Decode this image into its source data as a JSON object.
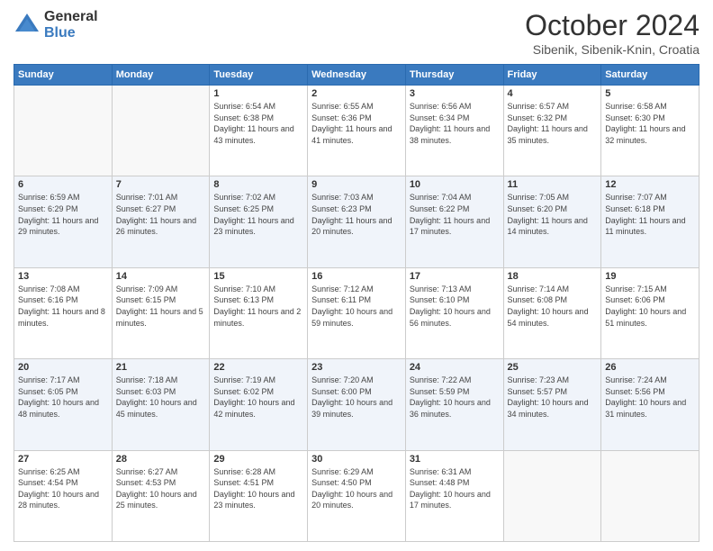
{
  "header": {
    "logo_general": "General",
    "logo_blue": "Blue",
    "month": "October 2024",
    "location": "Sibenik, Sibenik-Knin, Croatia"
  },
  "days_of_week": [
    "Sunday",
    "Monday",
    "Tuesday",
    "Wednesday",
    "Thursday",
    "Friday",
    "Saturday"
  ],
  "weeks": [
    [
      {
        "day": "",
        "info": ""
      },
      {
        "day": "",
        "info": ""
      },
      {
        "day": "1",
        "info": "Sunrise: 6:54 AM\nSunset: 6:38 PM\nDaylight: 11 hours and 43 minutes."
      },
      {
        "day": "2",
        "info": "Sunrise: 6:55 AM\nSunset: 6:36 PM\nDaylight: 11 hours and 41 minutes."
      },
      {
        "day": "3",
        "info": "Sunrise: 6:56 AM\nSunset: 6:34 PM\nDaylight: 11 hours and 38 minutes."
      },
      {
        "day": "4",
        "info": "Sunrise: 6:57 AM\nSunset: 6:32 PM\nDaylight: 11 hours and 35 minutes."
      },
      {
        "day": "5",
        "info": "Sunrise: 6:58 AM\nSunset: 6:30 PM\nDaylight: 11 hours and 32 minutes."
      }
    ],
    [
      {
        "day": "6",
        "info": "Sunrise: 6:59 AM\nSunset: 6:29 PM\nDaylight: 11 hours and 29 minutes."
      },
      {
        "day": "7",
        "info": "Sunrise: 7:01 AM\nSunset: 6:27 PM\nDaylight: 11 hours and 26 minutes."
      },
      {
        "day": "8",
        "info": "Sunrise: 7:02 AM\nSunset: 6:25 PM\nDaylight: 11 hours and 23 minutes."
      },
      {
        "day": "9",
        "info": "Sunrise: 7:03 AM\nSunset: 6:23 PM\nDaylight: 11 hours and 20 minutes."
      },
      {
        "day": "10",
        "info": "Sunrise: 7:04 AM\nSunset: 6:22 PM\nDaylight: 11 hours and 17 minutes."
      },
      {
        "day": "11",
        "info": "Sunrise: 7:05 AM\nSunset: 6:20 PM\nDaylight: 11 hours and 14 minutes."
      },
      {
        "day": "12",
        "info": "Sunrise: 7:07 AM\nSunset: 6:18 PM\nDaylight: 11 hours and 11 minutes."
      }
    ],
    [
      {
        "day": "13",
        "info": "Sunrise: 7:08 AM\nSunset: 6:16 PM\nDaylight: 11 hours and 8 minutes."
      },
      {
        "day": "14",
        "info": "Sunrise: 7:09 AM\nSunset: 6:15 PM\nDaylight: 11 hours and 5 minutes."
      },
      {
        "day": "15",
        "info": "Sunrise: 7:10 AM\nSunset: 6:13 PM\nDaylight: 11 hours and 2 minutes."
      },
      {
        "day": "16",
        "info": "Sunrise: 7:12 AM\nSunset: 6:11 PM\nDaylight: 10 hours and 59 minutes."
      },
      {
        "day": "17",
        "info": "Sunrise: 7:13 AM\nSunset: 6:10 PM\nDaylight: 10 hours and 56 minutes."
      },
      {
        "day": "18",
        "info": "Sunrise: 7:14 AM\nSunset: 6:08 PM\nDaylight: 10 hours and 54 minutes."
      },
      {
        "day": "19",
        "info": "Sunrise: 7:15 AM\nSunset: 6:06 PM\nDaylight: 10 hours and 51 minutes."
      }
    ],
    [
      {
        "day": "20",
        "info": "Sunrise: 7:17 AM\nSunset: 6:05 PM\nDaylight: 10 hours and 48 minutes."
      },
      {
        "day": "21",
        "info": "Sunrise: 7:18 AM\nSunset: 6:03 PM\nDaylight: 10 hours and 45 minutes."
      },
      {
        "day": "22",
        "info": "Sunrise: 7:19 AM\nSunset: 6:02 PM\nDaylight: 10 hours and 42 minutes."
      },
      {
        "day": "23",
        "info": "Sunrise: 7:20 AM\nSunset: 6:00 PM\nDaylight: 10 hours and 39 minutes."
      },
      {
        "day": "24",
        "info": "Sunrise: 7:22 AM\nSunset: 5:59 PM\nDaylight: 10 hours and 36 minutes."
      },
      {
        "day": "25",
        "info": "Sunrise: 7:23 AM\nSunset: 5:57 PM\nDaylight: 10 hours and 34 minutes."
      },
      {
        "day": "26",
        "info": "Sunrise: 7:24 AM\nSunset: 5:56 PM\nDaylight: 10 hours and 31 minutes."
      }
    ],
    [
      {
        "day": "27",
        "info": "Sunrise: 6:25 AM\nSunset: 4:54 PM\nDaylight: 10 hours and 28 minutes."
      },
      {
        "day": "28",
        "info": "Sunrise: 6:27 AM\nSunset: 4:53 PM\nDaylight: 10 hours and 25 minutes."
      },
      {
        "day": "29",
        "info": "Sunrise: 6:28 AM\nSunset: 4:51 PM\nDaylight: 10 hours and 23 minutes."
      },
      {
        "day": "30",
        "info": "Sunrise: 6:29 AM\nSunset: 4:50 PM\nDaylight: 10 hours and 20 minutes."
      },
      {
        "day": "31",
        "info": "Sunrise: 6:31 AM\nSunset: 4:48 PM\nDaylight: 10 hours and 17 minutes."
      },
      {
        "day": "",
        "info": ""
      },
      {
        "day": "",
        "info": ""
      }
    ]
  ]
}
